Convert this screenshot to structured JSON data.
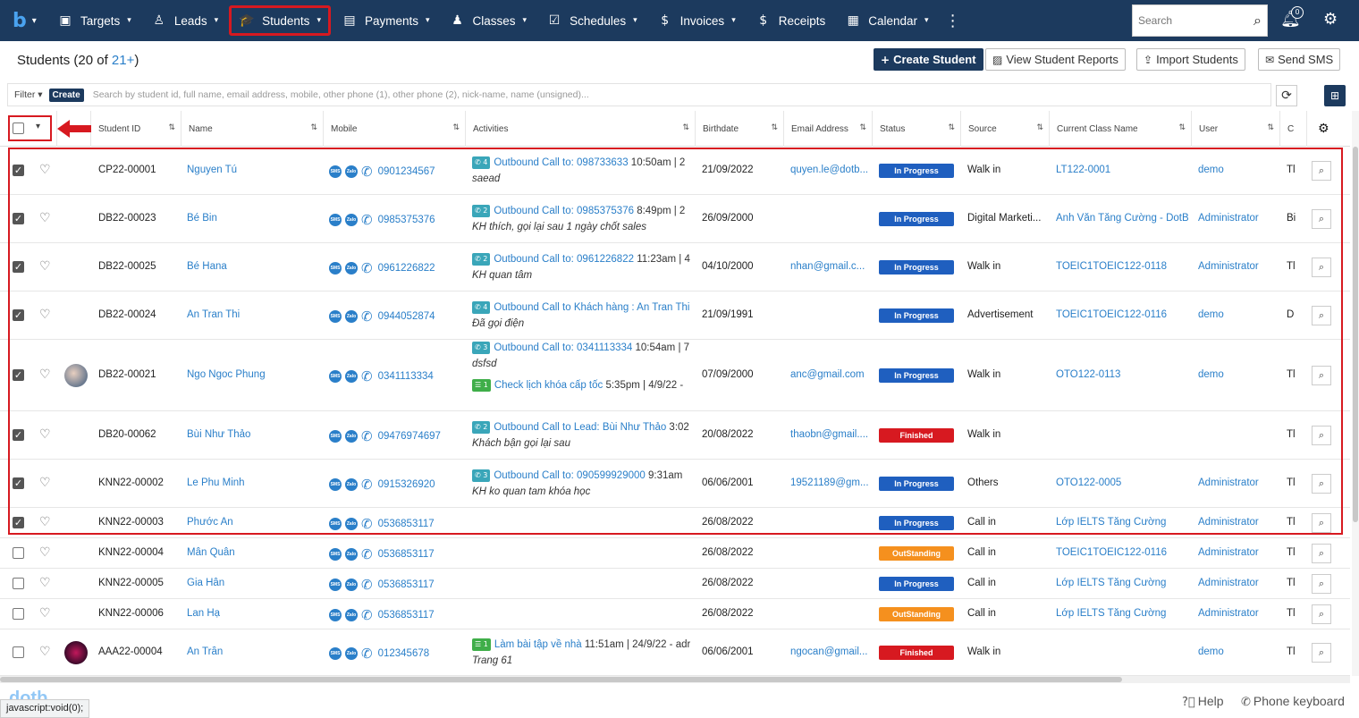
{
  "nav": {
    "logo": "b",
    "items": [
      {
        "label": "Targets",
        "icon": "target-icon",
        "glyph": "▣",
        "chev": true
      },
      {
        "label": "Leads",
        "icon": "leads-icon",
        "glyph": "♙",
        "chev": true
      },
      {
        "label": "Students",
        "icon": "graduation-cap-icon",
        "glyph": "🎓",
        "chev": true,
        "active": true
      },
      {
        "label": "Payments",
        "icon": "payments-icon",
        "glyph": "▤",
        "chev": true
      },
      {
        "label": "Classes",
        "icon": "classes-icon",
        "glyph": "♟",
        "chev": true
      },
      {
        "label": "Schedules",
        "icon": "schedule-icon",
        "glyph": "☑",
        "chev": true
      },
      {
        "label": "Invoices",
        "icon": "invoice-icon",
        "glyph": "$",
        "chev": true
      },
      {
        "label": "Receipts",
        "icon": "receipt-icon",
        "glyph": "$",
        "chev": false
      },
      {
        "label": "Calendar",
        "icon": "calendar-icon",
        "glyph": "▦",
        "chev": true
      }
    ],
    "search_placeholder": "Search",
    "notification_count": "0"
  },
  "header": {
    "title": "Students (20 of ",
    "count_link": "21+",
    "title_end": ")",
    "create_label": "Create Student",
    "reports_label": "View Student Reports",
    "import_label": "Import Students",
    "sms_label": "Send SMS"
  },
  "filter": {
    "filter_label": "Filter",
    "create_label": "Create",
    "placeholder": "Search by student id, full name, email address, mobile, other phone (1), other phone (2), nick-name, name (unsigned)..."
  },
  "columns": [
    "Student ID",
    "Name",
    "Mobile",
    "Activities",
    "Birthdate",
    "Email Address",
    "Status",
    "Source",
    "Current Class Name",
    "User",
    "C"
  ],
  "rows": [
    {
      "checked": true,
      "id": "CP22-00001",
      "name": "Nguyen Tú",
      "mobile": "0901234567",
      "act1_tag": "4",
      "act1_color": "#3aa6b9",
      "act1_link": "Outbound Call to: 098733633",
      "act1_rest": " 10:50am | 2",
      "act1_note": "saead",
      "birthdate": "21/09/2022",
      "email": "quyen.le@dotb...",
      "status": "In Progress",
      "status_color": "#1f5fbf",
      "source": "Walk in",
      "class": "LT122-0001",
      "user": "demo",
      "c": "Tl"
    },
    {
      "checked": true,
      "id": "DB22-00023",
      "name": "Bé Bin",
      "mobile": "0985375376",
      "act1_tag": "2",
      "act1_color": "#3aa6b9",
      "act1_link": "Outbound Call to: 0985375376",
      "act1_rest": " 8:49pm | 2",
      "act1_note": "KH thích, gọi lại sau 1 ngày chốt sales",
      "birthdate": "26/09/2000",
      "email": "",
      "status": "In Progress",
      "status_color": "#1f5fbf",
      "source": "Digital Marketi...",
      "class": "Anh Văn Tăng Cường - DotB",
      "user": "Administrator",
      "c": "Bi"
    },
    {
      "checked": true,
      "id": "DB22-00025",
      "name": "Bé Hana",
      "mobile": "0961226822",
      "act1_tag": "2",
      "act1_color": "#3aa6b9",
      "act1_link": "Outbound Call to: 0961226822",
      "act1_rest": " 11:23am | 4",
      "act1_note": "KH quan tâm",
      "birthdate": "04/10/2000",
      "email": "nhan@gmail.c...",
      "status": "In Progress",
      "status_color": "#1f5fbf",
      "source": "Walk in",
      "class": "TOEIC1TOEIC122-0118",
      "user": "Administrator",
      "c": "Tl"
    },
    {
      "checked": true,
      "id": "DB22-00024",
      "name": "An Tran Thi",
      "mobile": "0944052874",
      "act1_tag": "4",
      "act1_color": "#3aa6b9",
      "act1_link": "Outbound Call to Khách hàng : An Tran Thi",
      "act1_rest": "",
      "act1_note": "Đã gọi điện",
      "birthdate": "21/09/1991",
      "email": "",
      "status": "In Progress",
      "status_color": "#1f5fbf",
      "source": "Advertisement",
      "class": "TOEIC1TOEIC122-0116",
      "user": "demo",
      "c": "D"
    },
    {
      "checked": true,
      "id": "DB22-00021",
      "name": "Ngo Ngoc Phung",
      "mobile": "0341113334",
      "act1_tag": "3",
      "act1_color": "#3aa6b9",
      "act1_link": "Outbound Call to: 0341113334",
      "act1_rest": " 10:54am | 7",
      "act1_note": "dsfsd",
      "act2_tag": "1",
      "act2_color": "#3fae49",
      "act2_link": "Check lịch khóa cấp tốc",
      "act2_rest": " 5:35pm | 4/9/22 -",
      "birthdate": "07/09/2000",
      "email": "anc@gmail.com",
      "status": "In Progress",
      "status_color": "#1f5fbf",
      "source": "Walk in",
      "class": "OTO122-0113",
      "user": "demo",
      "c": "Tl"
    },
    {
      "checked": true,
      "id": "DB20-00062",
      "name": "Bùi Như Thảo",
      "mobile": "09476974697",
      "act1_tag": "2",
      "act1_color": "#3aa6b9",
      "act1_link": "Outbound Call to Lead: Bùi Như Thảo",
      "act1_rest": " 3:02",
      "act1_note": "Khách bận gọi lại sau",
      "birthdate": "20/08/2022",
      "email": "thaobn@gmail....",
      "status": "Finished",
      "status_color": "#d71920",
      "source": "Walk in",
      "class": "",
      "user": "",
      "c": "Tl"
    },
    {
      "checked": true,
      "id": "KNN22-00002",
      "name": "Le Phu Minh",
      "mobile": "0915326920",
      "act1_tag": "3",
      "act1_color": "#3aa6b9",
      "act1_link": "Outbound Call to: 090599929000",
      "act1_rest": " 9:31am",
      "act1_note": "KH ko quan tam khóa học",
      "birthdate": "06/06/2001",
      "email": "19521189@gm...",
      "status": "In Progress",
      "status_color": "#1f5fbf",
      "source": "Others",
      "class": "OTO122-0005",
      "user": "Administrator",
      "c": "Tl"
    },
    {
      "checked": true,
      "id": "KNN22-00003",
      "name": "Phước An",
      "mobile": "0536853117",
      "birthdate": "26/08/2022",
      "email": "",
      "status": "In Progress",
      "status_color": "#1f5fbf",
      "source": "Call in",
      "class": "Lớp IELTS Tăng Cường",
      "user": "Administrator",
      "c": "Tl"
    },
    {
      "checked": false,
      "id": "KNN22-00004",
      "name": "Mẫn Quân",
      "mobile": "0536853117",
      "birthdate": "26/08/2022",
      "email": "",
      "status": "OutStanding",
      "status_color": "#f5901e",
      "source": "Call in",
      "class": "TOEIC1TOEIC122-0116",
      "user": "Administrator",
      "c": "Tl"
    },
    {
      "checked": false,
      "id": "KNN22-00005",
      "name": "Gia Hân",
      "mobile": "0536853117",
      "birthdate": "26/08/2022",
      "email": "",
      "status": "In Progress",
      "status_color": "#1f5fbf",
      "source": "Call in",
      "class": "Lớp IELTS Tăng Cường",
      "user": "Administrator",
      "c": "Tl"
    },
    {
      "checked": false,
      "id": "KNN22-00006",
      "name": "Lan Hạ",
      "mobile": "0536853117",
      "birthdate": "26/08/2022",
      "email": "",
      "status": "OutStanding",
      "status_color": "#f5901e",
      "source": "Call in",
      "class": "Lớp IELTS Tăng Cường",
      "user": "Administrator",
      "c": "Tl"
    },
    {
      "checked": false,
      "id": "AAA22-00004",
      "name": "An Trần",
      "mobile": "012345678",
      "act1_tag": "1",
      "act1_color": "#3fae49",
      "act1_link": "Làm bài tập về nhà",
      "act1_rest": " 11:51am | 24/9/22 - adr",
      "act1_note": "Trang 61",
      "birthdate": "06/06/2001",
      "email": "ngocan@gmail...",
      "status": "Finished",
      "status_color": "#d71920",
      "source": "Walk in",
      "class": "",
      "user": "demo",
      "c": "Tl"
    }
  ],
  "footer": {
    "status_url": "javascript:void(0);",
    "help_label": "Help",
    "keyboard_label": "Phone keyboard"
  },
  "colors": {
    "nav_bg": "#1c3a5e",
    "link": "#2a7fc9",
    "highlight": "#d71920"
  }
}
